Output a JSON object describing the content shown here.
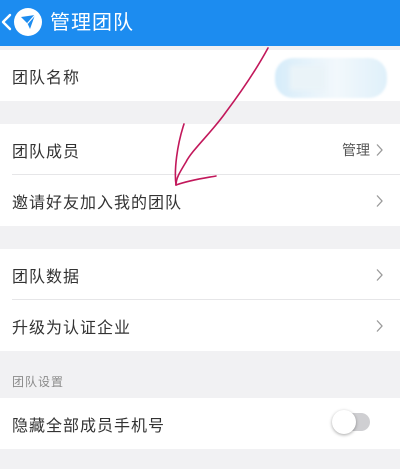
{
  "navbar": {
    "title": "管理团队",
    "background": "#1c8cf0"
  },
  "rows": {
    "team_name": {
      "label": "团队名称"
    },
    "members": {
      "label": "团队成员",
      "value": "管理"
    },
    "invite": {
      "label": "邀请好友加入我的团队"
    },
    "team_data": {
      "label": "团队数据"
    },
    "upgrade": {
      "label": "升级为认证企业"
    },
    "hide_phones": {
      "label": "隐藏全部成员手机号",
      "toggle_on": false
    }
  },
  "settings_group": {
    "header": "团队设置"
  },
  "icons": {
    "back": "chevron-left-icon",
    "logo": "app-logo-icon",
    "row_arrow": "chevron-right-icon"
  },
  "colors": {
    "accent": "#1c8cf0",
    "annotation": "#c2185b"
  }
}
